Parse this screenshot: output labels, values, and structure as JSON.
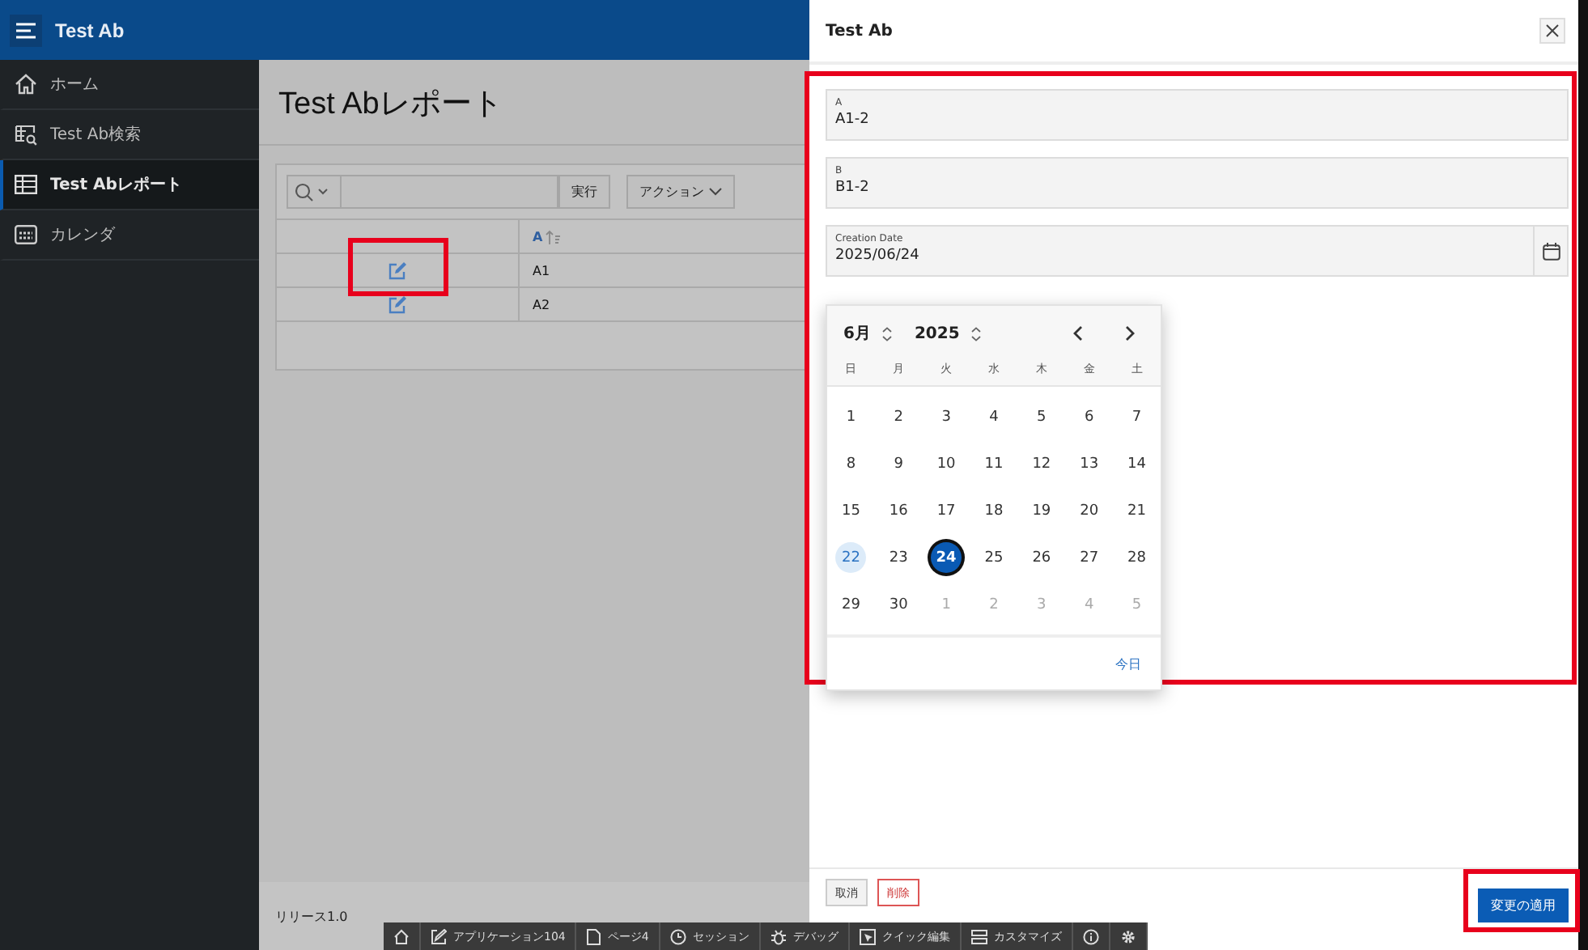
{
  "app": {
    "title": "Test Ab"
  },
  "sidebar": {
    "items": [
      {
        "label": "ホーム",
        "selected": false
      },
      {
        "label": "Test Ab検索",
        "selected": false
      },
      {
        "label": "Test Abレポート",
        "selected": true
      },
      {
        "label": "カレンダ",
        "selected": false
      }
    ]
  },
  "page": {
    "title": "Test Abレポート",
    "footer": "リリース1.0"
  },
  "report": {
    "go_button": "実行",
    "actions_button": "アクション",
    "columns": [
      {
        "label": "A",
        "sorted": true
      }
    ],
    "rows": [
      {
        "highlighted": true,
        "A": "A1"
      },
      {
        "highlighted": false,
        "A": "A2"
      }
    ]
  },
  "dialog": {
    "title": "Test Ab",
    "fields": [
      {
        "label": "A",
        "value": "A1-2",
        "kind": "text"
      },
      {
        "label": "B",
        "value": "B1-2",
        "kind": "text"
      },
      {
        "label": "Creation Date",
        "value": "2025/06/24",
        "kind": "date"
      }
    ],
    "calendar": {
      "month": "6月",
      "year": "2025",
      "weekdays": [
        "日",
        "月",
        "火",
        "水",
        "木",
        "金",
        "土"
      ],
      "weeks": [
        [
          {
            "day": "1",
            "outside": false,
            "selected": false,
            "today": false
          },
          {
            "day": "2",
            "outside": false,
            "selected": false,
            "today": false
          },
          {
            "day": "3",
            "outside": false,
            "selected": false,
            "today": false
          },
          {
            "day": "4",
            "outside": false,
            "selected": false,
            "today": false
          },
          {
            "day": "5",
            "outside": false,
            "selected": false,
            "today": false
          },
          {
            "day": "6",
            "outside": false,
            "selected": false,
            "today": false
          },
          {
            "day": "7",
            "outside": false,
            "selected": false,
            "today": false
          }
        ],
        [
          {
            "day": "8",
            "outside": false,
            "selected": false,
            "today": false
          },
          {
            "day": "9",
            "outside": false,
            "selected": false,
            "today": false
          },
          {
            "day": "10",
            "outside": false,
            "selected": false,
            "today": false
          },
          {
            "day": "11",
            "outside": false,
            "selected": false,
            "today": false
          },
          {
            "day": "12",
            "outside": false,
            "selected": false,
            "today": false
          },
          {
            "day": "13",
            "outside": false,
            "selected": false,
            "today": false
          },
          {
            "day": "14",
            "outside": false,
            "selected": false,
            "today": false
          }
        ],
        [
          {
            "day": "15",
            "outside": false,
            "selected": false,
            "today": false
          },
          {
            "day": "16",
            "outside": false,
            "selected": false,
            "today": false
          },
          {
            "day": "17",
            "outside": false,
            "selected": false,
            "today": false
          },
          {
            "day": "18",
            "outside": false,
            "selected": false,
            "today": false
          },
          {
            "day": "19",
            "outside": false,
            "selected": false,
            "today": false
          },
          {
            "day": "20",
            "outside": false,
            "selected": false,
            "today": false
          },
          {
            "day": "21",
            "outside": false,
            "selected": false,
            "today": false
          }
        ],
        [
          {
            "day": "22",
            "outside": false,
            "selected": false,
            "today": true
          },
          {
            "day": "23",
            "outside": false,
            "selected": false,
            "today": false
          },
          {
            "day": "24",
            "outside": false,
            "selected": true,
            "today": false
          },
          {
            "day": "25",
            "outside": false,
            "selected": false,
            "today": false
          },
          {
            "day": "26",
            "outside": false,
            "selected": false,
            "today": false
          },
          {
            "day": "27",
            "outside": false,
            "selected": false,
            "today": false
          },
          {
            "day": "28",
            "outside": false,
            "selected": false,
            "today": false
          }
        ],
        [
          {
            "day": "29",
            "outside": false,
            "selected": false,
            "today": false
          },
          {
            "day": "30",
            "outside": false,
            "selected": false,
            "today": false
          },
          {
            "day": "1",
            "outside": true,
            "selected": false,
            "today": false
          },
          {
            "day": "2",
            "outside": true,
            "selected": false,
            "today": false
          },
          {
            "day": "3",
            "outside": true,
            "selected": false,
            "today": false
          },
          {
            "day": "4",
            "outside": true,
            "selected": false,
            "today": false
          },
          {
            "day": "5",
            "outside": true,
            "selected": false,
            "today": false
          }
        ]
      ],
      "today_button": "今日"
    },
    "buttons": [
      {
        "label": "取消",
        "kind": "cancel"
      },
      {
        "label": "削除",
        "kind": "delete"
      },
      {
        "label": "変更の適用",
        "kind": "primary"
      }
    ]
  },
  "developer_toolbar": {
    "items": [
      {
        "label": "アプリケーション104"
      },
      {
        "label": "ページ4"
      },
      {
        "label": "セッション"
      },
      {
        "label": "デバッグ"
      },
      {
        "label": "クイック編集"
      },
      {
        "label": "カスタマイズ"
      }
    ]
  }
}
